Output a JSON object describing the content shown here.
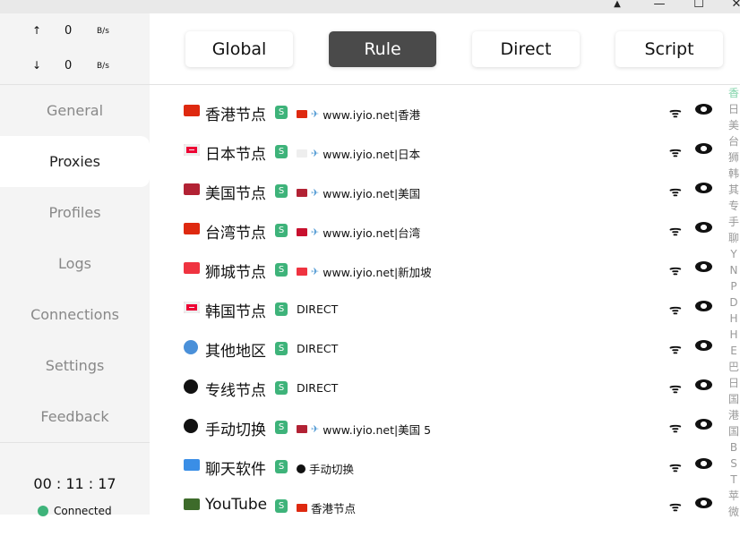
{
  "window": {
    "pin": "📌",
    "minimize": "—",
    "maximize": "☐",
    "close": "✕"
  },
  "traffic": {
    "up_arrow": "↑",
    "up_value": "0",
    "up_unit": "B/s",
    "down_arrow": "↓",
    "down_value": "0",
    "down_unit": "B/s"
  },
  "nav": [
    {
      "label": "General"
    },
    {
      "label": "Proxies",
      "active": true
    },
    {
      "label": "Profiles"
    },
    {
      "label": "Logs"
    },
    {
      "label": "Connections"
    },
    {
      "label": "Settings"
    },
    {
      "label": "Feedback"
    }
  ],
  "status": {
    "timer": "00 : 11 : 17",
    "connection": "Connected",
    "color": "#3eb37a"
  },
  "modes": [
    {
      "label": "Global"
    },
    {
      "label": "Rule",
      "active": true
    },
    {
      "label": "Direct"
    },
    {
      "label": "Script"
    }
  ],
  "groups": [
    {
      "icon": "flag-hk",
      "color": "#de2910",
      "name": "香港节点",
      "badge": "S",
      "sel_icon": "flag-hk",
      "sel_color": "#de2910",
      "plane": true,
      "selected": "www.iyio.net|香港"
    },
    {
      "icon": "flag-jp",
      "color": "#eeeeee",
      "name": "日本节点",
      "badge": "S",
      "sel_icon": "flag-jp",
      "sel_color": "#eeeeee",
      "plane": true,
      "selected": "www.iyio.net|日本"
    },
    {
      "icon": "flag-us",
      "color": "#b22234",
      "name": "美国节点",
      "badge": "S",
      "sel_icon": "flag-us",
      "sel_color": "#b22234",
      "plane": true,
      "selected": "www.iyio.net|美国"
    },
    {
      "icon": "flag-cn",
      "color": "#de2910",
      "name": "台湾节点",
      "badge": "S",
      "sel_icon": "flag-tw",
      "sel_color": "#c8102e",
      "plane": true,
      "selected": "www.iyio.net|台湾"
    },
    {
      "icon": "flag-sg",
      "color": "#ef3340",
      "name": "狮城节点",
      "badge": "S",
      "sel_icon": "flag-sg",
      "sel_color": "#ef3340",
      "plane": true,
      "selected": "www.iyio.net|新加坡"
    },
    {
      "icon": "flag-kr",
      "color": "#eeeeee",
      "name": "韩国节点",
      "badge": "S",
      "selected": "DIRECT"
    },
    {
      "icon": "globe",
      "color": "#4a90d9",
      "name": "其他地区",
      "badge": "S",
      "selected": "DIRECT"
    },
    {
      "icon": "recycle",
      "color": "#111111",
      "name": "专线节点",
      "badge": "S",
      "selected": "DIRECT"
    },
    {
      "icon": "recycle",
      "color": "#111111",
      "name": "手动切换",
      "badge": "S",
      "sel_icon": "flag-us",
      "sel_color": "#b22234",
      "plane": true,
      "selected": "www.iyio.net|美国 5"
    },
    {
      "icon": "mobile-phone",
      "color": "#3a8ee6",
      "name": "聊天软件",
      "badge": "S",
      "sel_icon": "recycle",
      "sel_color": "#111111",
      "selected": "手动切换"
    },
    {
      "icon": "clapper-board",
      "color": "#3d6b2a",
      "name": "YouTube",
      "badge": "S",
      "sel_icon": "flag-hk",
      "sel_color": "#de2910",
      "selected": "香港节点"
    }
  ],
  "row_icons": {
    "latency": "wifi-icon",
    "preview": "eye-icon"
  },
  "index": [
    "香",
    "日",
    "美",
    "台",
    "狮",
    "韩",
    "其",
    "专",
    "手",
    "聊",
    "Y",
    "N",
    "P",
    "D",
    "H",
    "H",
    "E",
    "巴",
    "日",
    "国",
    "港",
    "国",
    "B",
    "S",
    "T",
    "苹",
    "微"
  ]
}
